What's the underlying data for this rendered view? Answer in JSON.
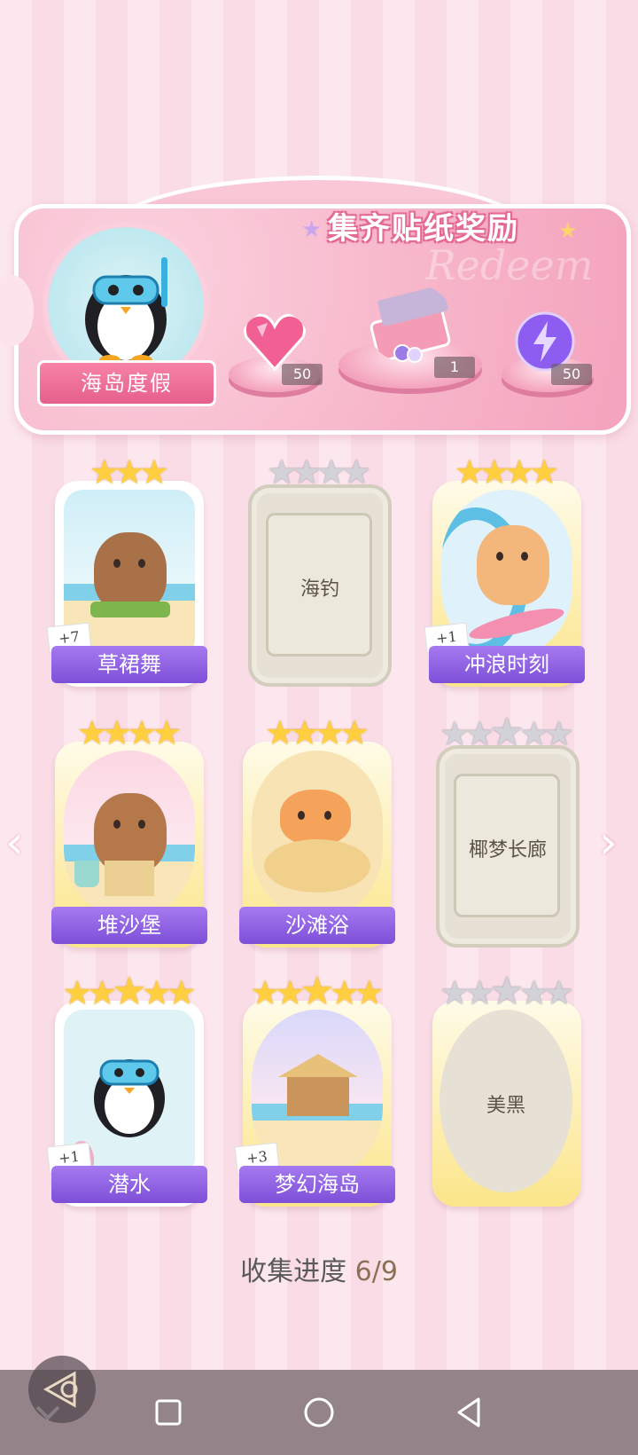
{
  "banner": {
    "title": "集齐贴纸奖励",
    "watermark": "Redeem",
    "album_name": "海岛度假",
    "rewards": [
      {
        "icon": "pink-heart-gem-icon",
        "quantity": "50"
      },
      {
        "icon": "gift-box-icon",
        "quantity": "1"
      },
      {
        "icon": "purple-lightning-orb-icon",
        "quantity": "50"
      }
    ]
  },
  "cards": [
    {
      "name": "草裙舞",
      "stars": 3,
      "collected": true,
      "extra": "+7"
    },
    {
      "name": "海钓",
      "stars": 4,
      "collected": false
    },
    {
      "name": "冲浪时刻",
      "stars": 4,
      "collected": true,
      "extra": "+1"
    },
    {
      "name": "堆沙堡",
      "stars": 4,
      "collected": true
    },
    {
      "name": "沙滩浴",
      "stars": 4,
      "collected": true
    },
    {
      "name": "椰梦长廊",
      "stars": 5,
      "collected": false
    },
    {
      "name": "潜水",
      "stars": 5,
      "collected": true,
      "extra": "+1"
    },
    {
      "name": "梦幻海岛",
      "stars": 5,
      "collected": true,
      "extra": "+3"
    },
    {
      "name": "美黑",
      "stars": 5,
      "collected": false
    }
  ],
  "progress": {
    "label": "收集进度",
    "value": "6/9"
  },
  "nav": {
    "left_arrow": "‹",
    "right_arrow": "›"
  },
  "colors": {
    "accent_purple": "#8b5ce0",
    "banner_pink": "#f7b6ca",
    "gold": "#ffcf3f"
  }
}
